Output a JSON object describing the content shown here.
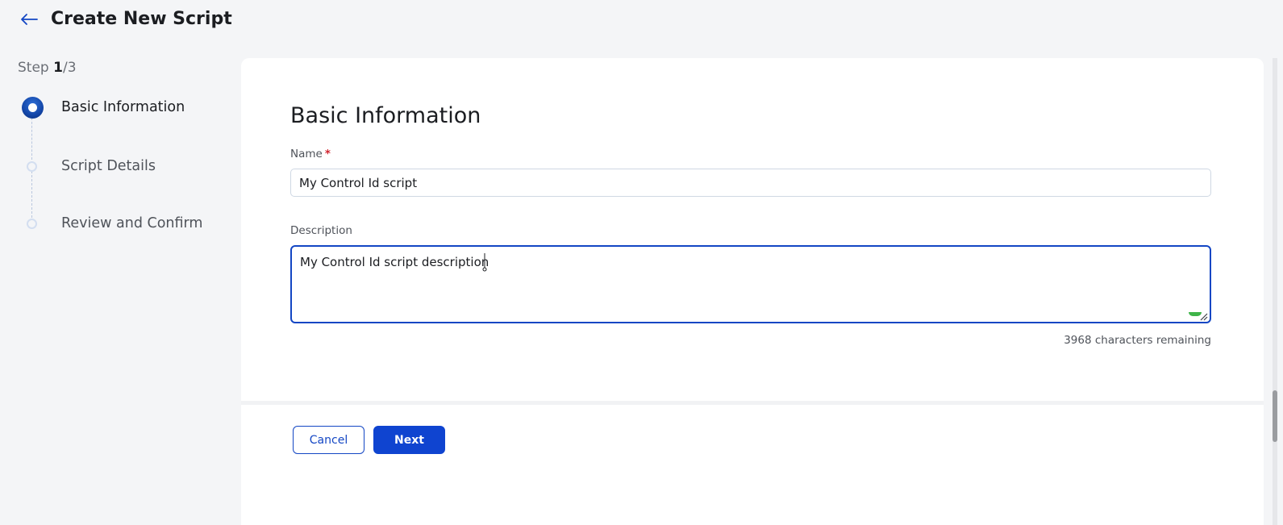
{
  "header": {
    "title": "Create New Script",
    "back_icon": "arrow-left-icon"
  },
  "stepper": {
    "step_prefix": "Step ",
    "current_step": "1",
    "total_steps": "/3",
    "steps": [
      {
        "label": "Basic Information",
        "state": "active"
      },
      {
        "label": "Script Details",
        "state": "pending"
      },
      {
        "label": "Review and Confirm",
        "state": "pending"
      }
    ]
  },
  "form": {
    "title": "Basic Information",
    "name": {
      "label": "Name",
      "required_mark": "*",
      "value": "My Control Id script"
    },
    "description": {
      "label": "Description",
      "value": "My Control Id script description",
      "chars_remaining": "3968 characters remaining"
    }
  },
  "actions": {
    "cancel_label": "Cancel",
    "next_label": "Next"
  },
  "colors": {
    "primary": "#0f44d0",
    "focus_border": "#1346c4",
    "required": "#d1242f",
    "background": "#f4f5f7"
  }
}
